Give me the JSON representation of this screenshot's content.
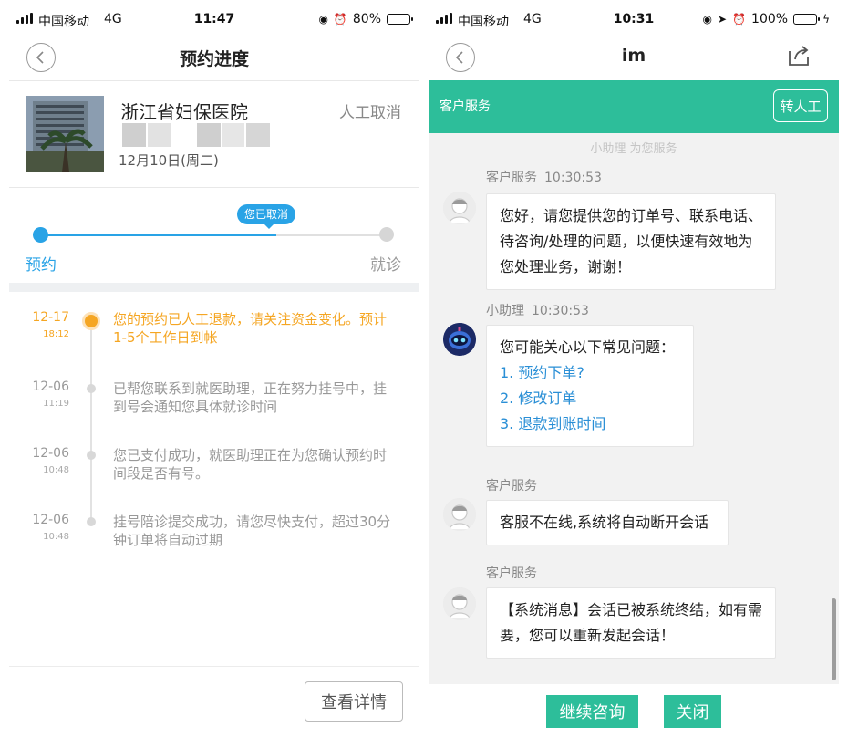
{
  "left": {
    "status": {
      "carrier": "中国移动",
      "network": "4G",
      "time": "11:47",
      "battery": "80%",
      "battery_level": 0.8
    },
    "nav": {
      "title": "预约进度"
    },
    "hospital": {
      "name": "浙江省妇保医院",
      "status": "人工取消",
      "date": "12月10日(周二)"
    },
    "progress": {
      "bubble": "您已取消",
      "start_label": "预约",
      "end_label": "就诊",
      "fraction": 0.68
    },
    "timeline": [
      {
        "date": "12-17",
        "time": "18:12",
        "text": "您的预约已人工退款，请关注资金变化。预计1-5个工作日到帐"
      },
      {
        "date": "12-06",
        "time": "11:19",
        "text": "已帮您联系到就医助理，正在努力挂号中，挂到号会通知您具体就诊时间"
      },
      {
        "date": "12-06",
        "time": "10:48",
        "text": "您已支付成功，就医助理正在为您确认预约时间段是否有号。"
      },
      {
        "date": "12-06",
        "time": "10:48",
        "text": "挂号陪诊提交成功，请您尽快支付，超过30分钟订单将自动过期"
      }
    ],
    "detail_button": "查看详情"
  },
  "right": {
    "status": {
      "carrier": "中国移动",
      "network": "4G",
      "time": "10:31",
      "battery": "100%",
      "battery_level": 1.0
    },
    "nav": {
      "title": "im"
    },
    "cs_bar": {
      "title": "客户服务",
      "transfer_button": "转人工"
    },
    "assist_note": "小助理 为您服务",
    "messages": [
      {
        "sender": "客户服务",
        "time": "10:30:53",
        "text": "您好，请您提供您的订单号、联系电话、待咨询/处理的问题，以便快速有效地为您处理业务，谢谢！"
      },
      {
        "sender": "小助理",
        "time": "10:30:53",
        "intro": "您可能关心以下常见问题：",
        "faq": [
          "1. 预约下单?",
          "2. 修改订单",
          "3. 退款到账时间"
        ]
      },
      {
        "sender": "客户服务",
        "time": "",
        "text": "客服不在线,系统将自动断开会话"
      },
      {
        "sender": "客户服务",
        "time": "",
        "text": "【系统消息】会话已被系统终结，如有需要，您可以重新发起会话！"
      }
    ],
    "buttons": {
      "continue": "继续咨询",
      "close": "关闭"
    }
  },
  "colors": {
    "accent_blue": "#29a3e6",
    "accent_orange": "#f5a623",
    "accent_green": "#2dbe9a"
  }
}
